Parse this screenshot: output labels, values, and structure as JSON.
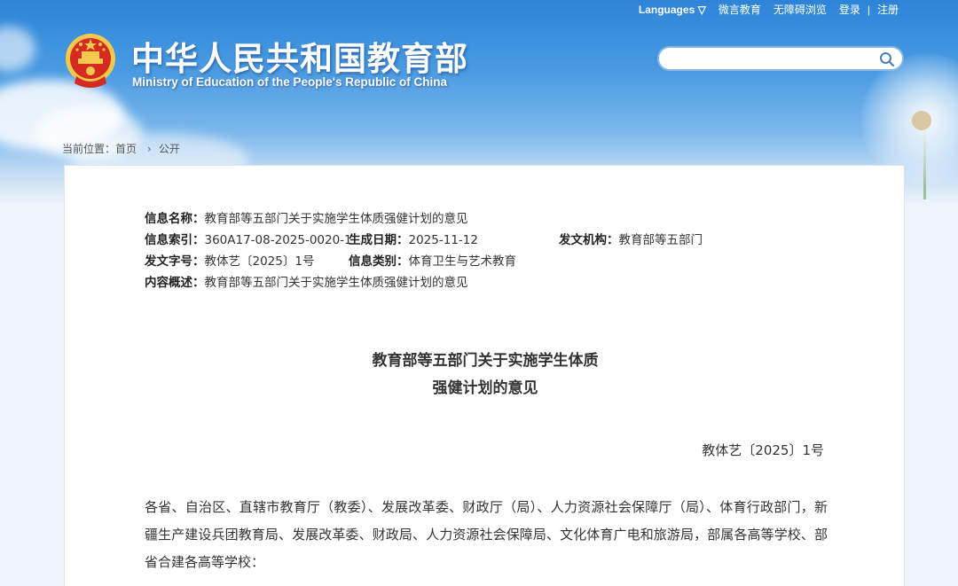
{
  "header": {
    "top_links": [
      "Languages",
      "微言教育",
      "无障碍浏览",
      "登录",
      "注册"
    ],
    "title_cn": "中华人民共和国教育部",
    "title_en": "Ministry of Education of the People's Republic of China",
    "search_placeholder": ""
  },
  "breadcrumb": {
    "prefix": "当前位置：",
    "home": "首页",
    "current": "公开"
  },
  "meta": {
    "name_label": "信息名称：",
    "name_value": "教育部等五部门关于实施学生体质强健计划的意见",
    "index_label": "信息索引：",
    "index_value": "360A17-08-2025-0020-1",
    "date_label": "生成日期：",
    "date_value": "2025-11-12",
    "org_label": "发文机构：",
    "org_value": "教育部等五部门",
    "docno_label": "发文字号：",
    "docno_value": "教体艺〔2025〕1号",
    "category_label": "信息类别：",
    "category_value": "体育卫生与艺术教育",
    "summary_label": "内容概述：",
    "summary_value": "教育部等五部门关于实施学生体质强健计划的意见"
  },
  "document": {
    "title_line1": "教育部等五部门关于实施学生体质",
    "title_line2": "强健计划的意见",
    "doc_number": "教体艺〔2025〕1号",
    "salutation": "各省、自治区、直辖市教育厅（教委）、发展改革委、财政厅（局）、人力资源社会保障厅（局）、体育行政部门，新疆生产建设兵团教育局、发展改革委、财政局、人力资源社会保障局、文化体育广电和旅游局，部属各高等学校、部省合建各高等学校："
  },
  "colors": {
    "header_blue": "#2d84d8",
    "emblem_red": "#d42a1f",
    "emblem_gold": "#f2c94c"
  }
}
